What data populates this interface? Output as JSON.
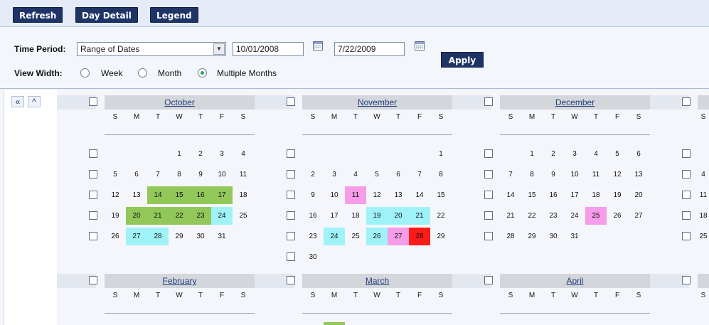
{
  "toolbar": {
    "refresh": "Refresh",
    "day_detail": "Day Detail",
    "legend": "Legend"
  },
  "controls": {
    "time_period_label": "Time Period:",
    "time_period_value": "Range of Dates",
    "start_date": "10/01/2008",
    "end_date": "7/22/2009",
    "apply": "Apply",
    "view_width_label": "View Width:",
    "view_options": [
      "Week",
      "Month",
      "Multiple Months"
    ],
    "view_selected": "Multiple Months"
  },
  "weekday_headers": [
    "S",
    "M",
    "T",
    "W",
    "T",
    "F",
    "S"
  ],
  "months_row1": [
    {
      "name": "October",
      "offset": 3,
      "days": 31,
      "colors": {
        "14": "green",
        "15": "green",
        "16": "green",
        "17": "green",
        "20": "green",
        "21": "green",
        "22": "green",
        "23": "green",
        "24": "cyan",
        "27": "cyan",
        "28": "cyan"
      }
    },
    {
      "name": "November",
      "offset": 6,
      "days": 30,
      "colors": {
        "11": "pink",
        "19": "cyan",
        "20": "cyan",
        "21": "cyan",
        "24": "cyan",
        "26": "cyan",
        "27": "pink",
        "28": "red"
      }
    },
    {
      "name": "December",
      "offset": 1,
      "days": 31,
      "colors": {
        "25": "pink"
      }
    }
  ],
  "months_row2": [
    "February",
    "March",
    "April"
  ],
  "partial_month_days": [
    "4",
    "11",
    "18",
    "25"
  ],
  "colors": {
    "green": "#92c75a",
    "cyan": "#9ff3f8",
    "pink": "#f69ce8",
    "red": "#ff1a1a",
    "toolbar_button": "#1f3466"
  }
}
